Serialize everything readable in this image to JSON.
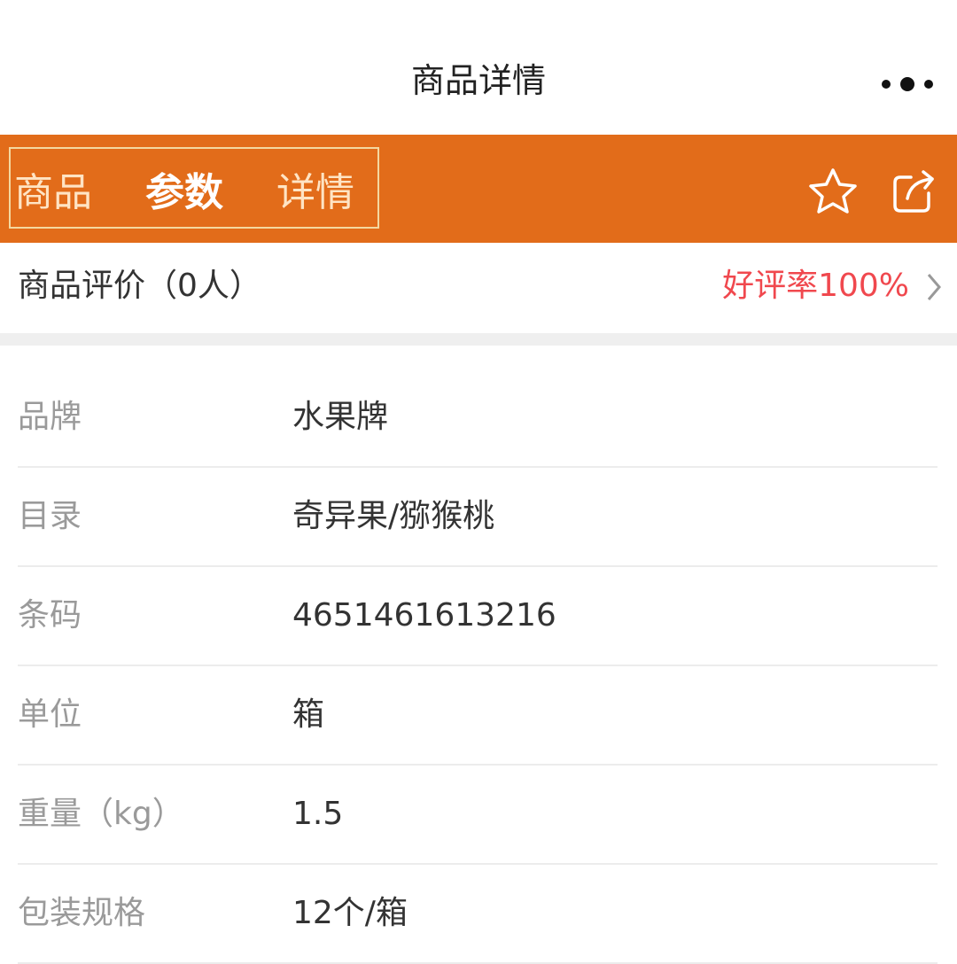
{
  "header": {
    "title": "商品详情"
  },
  "tabs": [
    {
      "label": "商品",
      "active": false
    },
    {
      "label": "参数",
      "active": true
    },
    {
      "label": "详情",
      "active": false
    }
  ],
  "icons": {
    "more": "more-dots-icon",
    "favorite": "star-icon",
    "share": "share-icon",
    "chevron": "chevron-right-icon"
  },
  "colors": {
    "accent": "#e26c1a",
    "rate": "#f0484e"
  },
  "review": {
    "label": "商品评价（0人）",
    "rate": "好评率100%"
  },
  "specs": [
    {
      "key": "品牌",
      "value": "水果牌"
    },
    {
      "key": "目录",
      "value": "奇异果/猕猴桃"
    },
    {
      "key": "条码",
      "value": "4651461613216"
    },
    {
      "key": "单位",
      "value": "箱"
    },
    {
      "key": "重量（kg）",
      "value": "1.5"
    },
    {
      "key": "包装规格",
      "value": "12个/箱"
    }
  ]
}
